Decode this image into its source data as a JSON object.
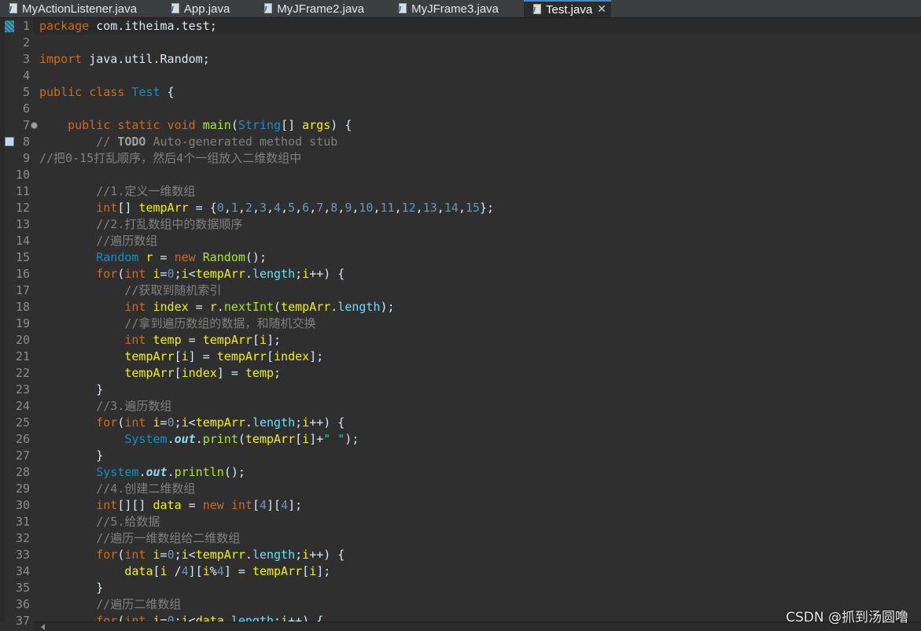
{
  "tabs": [
    {
      "label": "MyActionListener.java",
      "active": false
    },
    {
      "label": "App.java",
      "active": false
    },
    {
      "label": "MyJFrame2.java",
      "active": false
    },
    {
      "label": "MyJFrame3.java",
      "active": false
    },
    {
      "label": "Test.java",
      "active": true
    }
  ],
  "close_glyph": "✕",
  "watermark": "CSDN @抓到汤圆噜",
  "colors": {
    "keyword": "#cc6c1d",
    "type": "#1290c3",
    "comment": "#808080",
    "number": "#6897bb",
    "string": "#17c6a3",
    "local_var": "#f2f200",
    "method": "#a7ec21",
    "background": "#2f2f2f"
  },
  "editor": {
    "lines": [
      {
        "n": "1",
        "tokens": [
          [
            "kw",
            "package"
          ],
          [
            "plain",
            " com.itheima.test;"
          ]
        ]
      },
      {
        "n": "2",
        "tokens": []
      },
      {
        "n": "3",
        "tokens": [
          [
            "kw",
            "import"
          ],
          [
            "plain",
            " java.util.Random;"
          ]
        ]
      },
      {
        "n": "4",
        "tokens": []
      },
      {
        "n": "5",
        "tokens": [
          [
            "kw",
            "public"
          ],
          [
            "plain",
            " "
          ],
          [
            "kw",
            "class"
          ],
          [
            "plain",
            " "
          ],
          [
            "cls",
            "Test"
          ],
          [
            "plain",
            " {"
          ]
        ]
      },
      {
        "n": "6",
        "tokens": []
      },
      {
        "n": "7",
        "tokens": [
          [
            "plain",
            "    "
          ],
          [
            "kw",
            "public"
          ],
          [
            "plain",
            " "
          ],
          [
            "kw",
            "static"
          ],
          [
            "plain",
            " "
          ],
          [
            "kw",
            "void"
          ],
          [
            "plain",
            " "
          ],
          [
            "meth",
            "main"
          ],
          [
            "plain",
            "("
          ],
          [
            "cls",
            "String"
          ],
          [
            "plain",
            "[] "
          ],
          [
            "var",
            "args"
          ],
          [
            "plain",
            ") {"
          ]
        ]
      },
      {
        "n": "8",
        "tokens": [
          [
            "plain",
            "        "
          ],
          [
            "cm",
            "// "
          ],
          [
            "todo",
            "TODO"
          ],
          [
            "cm",
            " Auto-generated method stub"
          ]
        ]
      },
      {
        "n": "9",
        "tokens": [
          [
            "cm",
            "//把0-15打乱顺序，然后4个一组放入二维数组中"
          ]
        ],
        "indent0": true
      },
      {
        "n": "10",
        "tokens": []
      },
      {
        "n": "11",
        "tokens": [
          [
            "plain",
            "        "
          ],
          [
            "cm",
            "//1.定义一维数组"
          ]
        ]
      },
      {
        "n": "12",
        "tokens": [
          [
            "plain",
            "        "
          ],
          [
            "kw",
            "int"
          ],
          [
            "plain",
            "[] "
          ],
          [
            "var",
            "tempArr"
          ],
          [
            "plain",
            " = {"
          ],
          [
            "num",
            "0"
          ],
          [
            "plain",
            ","
          ],
          [
            "num",
            "1"
          ],
          [
            "plain",
            ","
          ],
          [
            "num",
            "2"
          ],
          [
            "plain",
            ","
          ],
          [
            "num",
            "3"
          ],
          [
            "plain",
            ","
          ],
          [
            "num",
            "4"
          ],
          [
            "plain",
            ","
          ],
          [
            "num",
            "5"
          ],
          [
            "plain",
            ","
          ],
          [
            "num",
            "6"
          ],
          [
            "plain",
            ","
          ],
          [
            "num",
            "7"
          ],
          [
            "plain",
            ","
          ],
          [
            "num",
            "8"
          ],
          [
            "plain",
            ","
          ],
          [
            "num",
            "9"
          ],
          [
            "plain",
            ","
          ],
          [
            "num",
            "10"
          ],
          [
            "plain",
            ","
          ],
          [
            "num",
            "11"
          ],
          [
            "plain",
            ","
          ],
          [
            "num",
            "12"
          ],
          [
            "plain",
            ","
          ],
          [
            "num",
            "13"
          ],
          [
            "plain",
            ","
          ],
          [
            "num",
            "14"
          ],
          [
            "plain",
            ","
          ],
          [
            "num",
            "15"
          ],
          [
            "plain",
            "};"
          ]
        ]
      },
      {
        "n": "13",
        "tokens": [
          [
            "plain",
            "        "
          ],
          [
            "cm",
            "//2.打乱数组中的数据顺序"
          ]
        ]
      },
      {
        "n": "14",
        "tokens": [
          [
            "plain",
            "        "
          ],
          [
            "cm",
            "//遍历数组"
          ]
        ]
      },
      {
        "n": "15",
        "tokens": [
          [
            "plain",
            "        "
          ],
          [
            "cls",
            "Random"
          ],
          [
            "plain",
            " "
          ],
          [
            "var",
            "r"
          ],
          [
            "plain",
            " = "
          ],
          [
            "kw",
            "new"
          ],
          [
            "plain",
            " "
          ],
          [
            "meth",
            "Random"
          ],
          [
            "plain",
            "();"
          ]
        ]
      },
      {
        "n": "16",
        "tokens": [
          [
            "plain",
            "        "
          ],
          [
            "kw",
            "for"
          ],
          [
            "plain",
            "("
          ],
          [
            "kw",
            "int"
          ],
          [
            "plain",
            " "
          ],
          [
            "var",
            "i"
          ],
          [
            "plain",
            "="
          ],
          [
            "num",
            "0"
          ],
          [
            "plain",
            ";"
          ],
          [
            "var",
            "i"
          ],
          [
            "plain",
            "<"
          ],
          [
            "var",
            "tempArr"
          ],
          [
            "plain",
            "."
          ],
          [
            "fld",
            "length"
          ],
          [
            "plain",
            ";"
          ],
          [
            "var",
            "i"
          ],
          [
            "plain",
            "++) {"
          ]
        ]
      },
      {
        "n": "17",
        "tokens": [
          [
            "plain",
            "            "
          ],
          [
            "cm",
            "//获取到随机索引"
          ]
        ]
      },
      {
        "n": "18",
        "tokens": [
          [
            "plain",
            "            "
          ],
          [
            "kw",
            "int"
          ],
          [
            "plain",
            " "
          ],
          [
            "var",
            "index"
          ],
          [
            "plain",
            " = "
          ],
          [
            "var",
            "r"
          ],
          [
            "plain",
            "."
          ],
          [
            "meth",
            "nextInt"
          ],
          [
            "plain",
            "("
          ],
          [
            "var",
            "tempArr"
          ],
          [
            "plain",
            "."
          ],
          [
            "fld",
            "length"
          ],
          [
            "plain",
            ");"
          ]
        ]
      },
      {
        "n": "19",
        "tokens": [
          [
            "plain",
            "            "
          ],
          [
            "cm",
            "//拿到遍历数组的数据，和随机交换"
          ]
        ]
      },
      {
        "n": "20",
        "tokens": [
          [
            "plain",
            "            "
          ],
          [
            "kw",
            "int"
          ],
          [
            "plain",
            " "
          ],
          [
            "var",
            "temp"
          ],
          [
            "plain",
            " = "
          ],
          [
            "var",
            "tempArr"
          ],
          [
            "plain",
            "["
          ],
          [
            "var",
            "i"
          ],
          [
            "plain",
            "];"
          ]
        ]
      },
      {
        "n": "21",
        "tokens": [
          [
            "plain",
            "            "
          ],
          [
            "var",
            "tempArr"
          ],
          [
            "plain",
            "["
          ],
          [
            "var",
            "i"
          ],
          [
            "plain",
            "] = "
          ],
          [
            "var",
            "tempArr"
          ],
          [
            "plain",
            "["
          ],
          [
            "var",
            "index"
          ],
          [
            "plain",
            "];"
          ]
        ]
      },
      {
        "n": "22",
        "tokens": [
          [
            "plain",
            "            "
          ],
          [
            "var",
            "tempArr"
          ],
          [
            "plain",
            "["
          ],
          [
            "var",
            "index"
          ],
          [
            "plain",
            "] = "
          ],
          [
            "var",
            "temp"
          ],
          [
            "plain",
            ";"
          ]
        ]
      },
      {
        "n": "23",
        "tokens": [
          [
            "plain",
            "        }"
          ]
        ]
      },
      {
        "n": "24",
        "tokens": [
          [
            "plain",
            "        "
          ],
          [
            "cm",
            "//3.遍历数组"
          ]
        ]
      },
      {
        "n": "25",
        "tokens": [
          [
            "plain",
            "        "
          ],
          [
            "kw",
            "for"
          ],
          [
            "plain",
            "("
          ],
          [
            "kw",
            "int"
          ],
          [
            "plain",
            " "
          ],
          [
            "var",
            "i"
          ],
          [
            "plain",
            "="
          ],
          [
            "num",
            "0"
          ],
          [
            "plain",
            ";"
          ],
          [
            "var",
            "i"
          ],
          [
            "plain",
            "<"
          ],
          [
            "var",
            "tempArr"
          ],
          [
            "plain",
            "."
          ],
          [
            "fld",
            "length"
          ],
          [
            "plain",
            ";"
          ],
          [
            "var",
            "i"
          ],
          [
            "plain",
            "++) {"
          ]
        ]
      },
      {
        "n": "26",
        "tokens": [
          [
            "plain",
            "            "
          ],
          [
            "cls",
            "System"
          ],
          [
            "plain",
            "."
          ],
          [
            "sfld",
            "out"
          ],
          [
            "plain",
            "."
          ],
          [
            "meth",
            "print"
          ],
          [
            "plain",
            "("
          ],
          [
            "var",
            "tempArr"
          ],
          [
            "plain",
            "["
          ],
          [
            "var",
            "i"
          ],
          [
            "plain",
            "]+"
          ],
          [
            "str",
            "\" \""
          ],
          [
            "plain",
            ");"
          ]
        ]
      },
      {
        "n": "27",
        "tokens": [
          [
            "plain",
            "        }"
          ]
        ]
      },
      {
        "n": "28",
        "tokens": [
          [
            "plain",
            "        "
          ],
          [
            "cls",
            "System"
          ],
          [
            "plain",
            "."
          ],
          [
            "sfld",
            "out"
          ],
          [
            "plain",
            "."
          ],
          [
            "meth",
            "println"
          ],
          [
            "plain",
            "();"
          ]
        ]
      },
      {
        "n": "29",
        "tokens": [
          [
            "plain",
            "        "
          ],
          [
            "cm",
            "//4.创建二维数组"
          ]
        ]
      },
      {
        "n": "30",
        "tokens": [
          [
            "plain",
            "        "
          ],
          [
            "kw",
            "int"
          ],
          [
            "plain",
            "[][] "
          ],
          [
            "var",
            "data"
          ],
          [
            "plain",
            " = "
          ],
          [
            "kw",
            "new"
          ],
          [
            "plain",
            " "
          ],
          [
            "kw",
            "int"
          ],
          [
            "plain",
            "["
          ],
          [
            "num",
            "4"
          ],
          [
            "plain",
            "]["
          ],
          [
            "num",
            "4"
          ],
          [
            "plain",
            "];"
          ]
        ]
      },
      {
        "n": "31",
        "tokens": [
          [
            "plain",
            "        "
          ],
          [
            "cm",
            "//5.给数据"
          ]
        ]
      },
      {
        "n": "32",
        "tokens": [
          [
            "plain",
            "        "
          ],
          [
            "cm",
            "//遍历一维数组给二维数组"
          ]
        ]
      },
      {
        "n": "33",
        "tokens": [
          [
            "plain",
            "        "
          ],
          [
            "kw",
            "for"
          ],
          [
            "plain",
            "("
          ],
          [
            "kw",
            "int"
          ],
          [
            "plain",
            " "
          ],
          [
            "var",
            "i"
          ],
          [
            "plain",
            "="
          ],
          [
            "num",
            "0"
          ],
          [
            "plain",
            ";"
          ],
          [
            "var",
            "i"
          ],
          [
            "plain",
            "<"
          ],
          [
            "var",
            "tempArr"
          ],
          [
            "plain",
            "."
          ],
          [
            "fld",
            "length"
          ],
          [
            "plain",
            ";"
          ],
          [
            "var",
            "i"
          ],
          [
            "plain",
            "++) {"
          ]
        ]
      },
      {
        "n": "34",
        "tokens": [
          [
            "plain",
            "            "
          ],
          [
            "var",
            "data"
          ],
          [
            "plain",
            "["
          ],
          [
            "var",
            "i"
          ],
          [
            "plain",
            " /"
          ],
          [
            "num",
            "4"
          ],
          [
            "plain",
            "]["
          ],
          [
            "var",
            "i"
          ],
          [
            "plain",
            "%"
          ],
          [
            "num",
            "4"
          ],
          [
            "plain",
            "] = "
          ],
          [
            "var",
            "tempArr"
          ],
          [
            "plain",
            "["
          ],
          [
            "var",
            "i"
          ],
          [
            "plain",
            "];"
          ]
        ]
      },
      {
        "n": "35",
        "tokens": [
          [
            "plain",
            "        }"
          ]
        ]
      },
      {
        "n": "36",
        "tokens": [
          [
            "plain",
            "        "
          ],
          [
            "cm",
            "//遍历二维数组"
          ]
        ]
      },
      {
        "n": "37",
        "tokens": [
          [
            "plain",
            "        "
          ],
          [
            "kw",
            "for"
          ],
          [
            "plain",
            "("
          ],
          [
            "kw",
            "int"
          ],
          [
            "plain",
            " "
          ],
          [
            "var",
            "i"
          ],
          [
            "plain",
            "="
          ],
          [
            "num",
            "0"
          ],
          [
            "plain",
            ";"
          ],
          [
            "var",
            "i"
          ],
          [
            "plain",
            "<"
          ],
          [
            "var",
            "data"
          ],
          [
            "plain",
            "."
          ],
          [
            "fld",
            "length"
          ],
          [
            "plain",
            ";"
          ],
          [
            "var",
            "i"
          ],
          [
            "plain",
            "++) {"
          ]
        ]
      }
    ]
  }
}
